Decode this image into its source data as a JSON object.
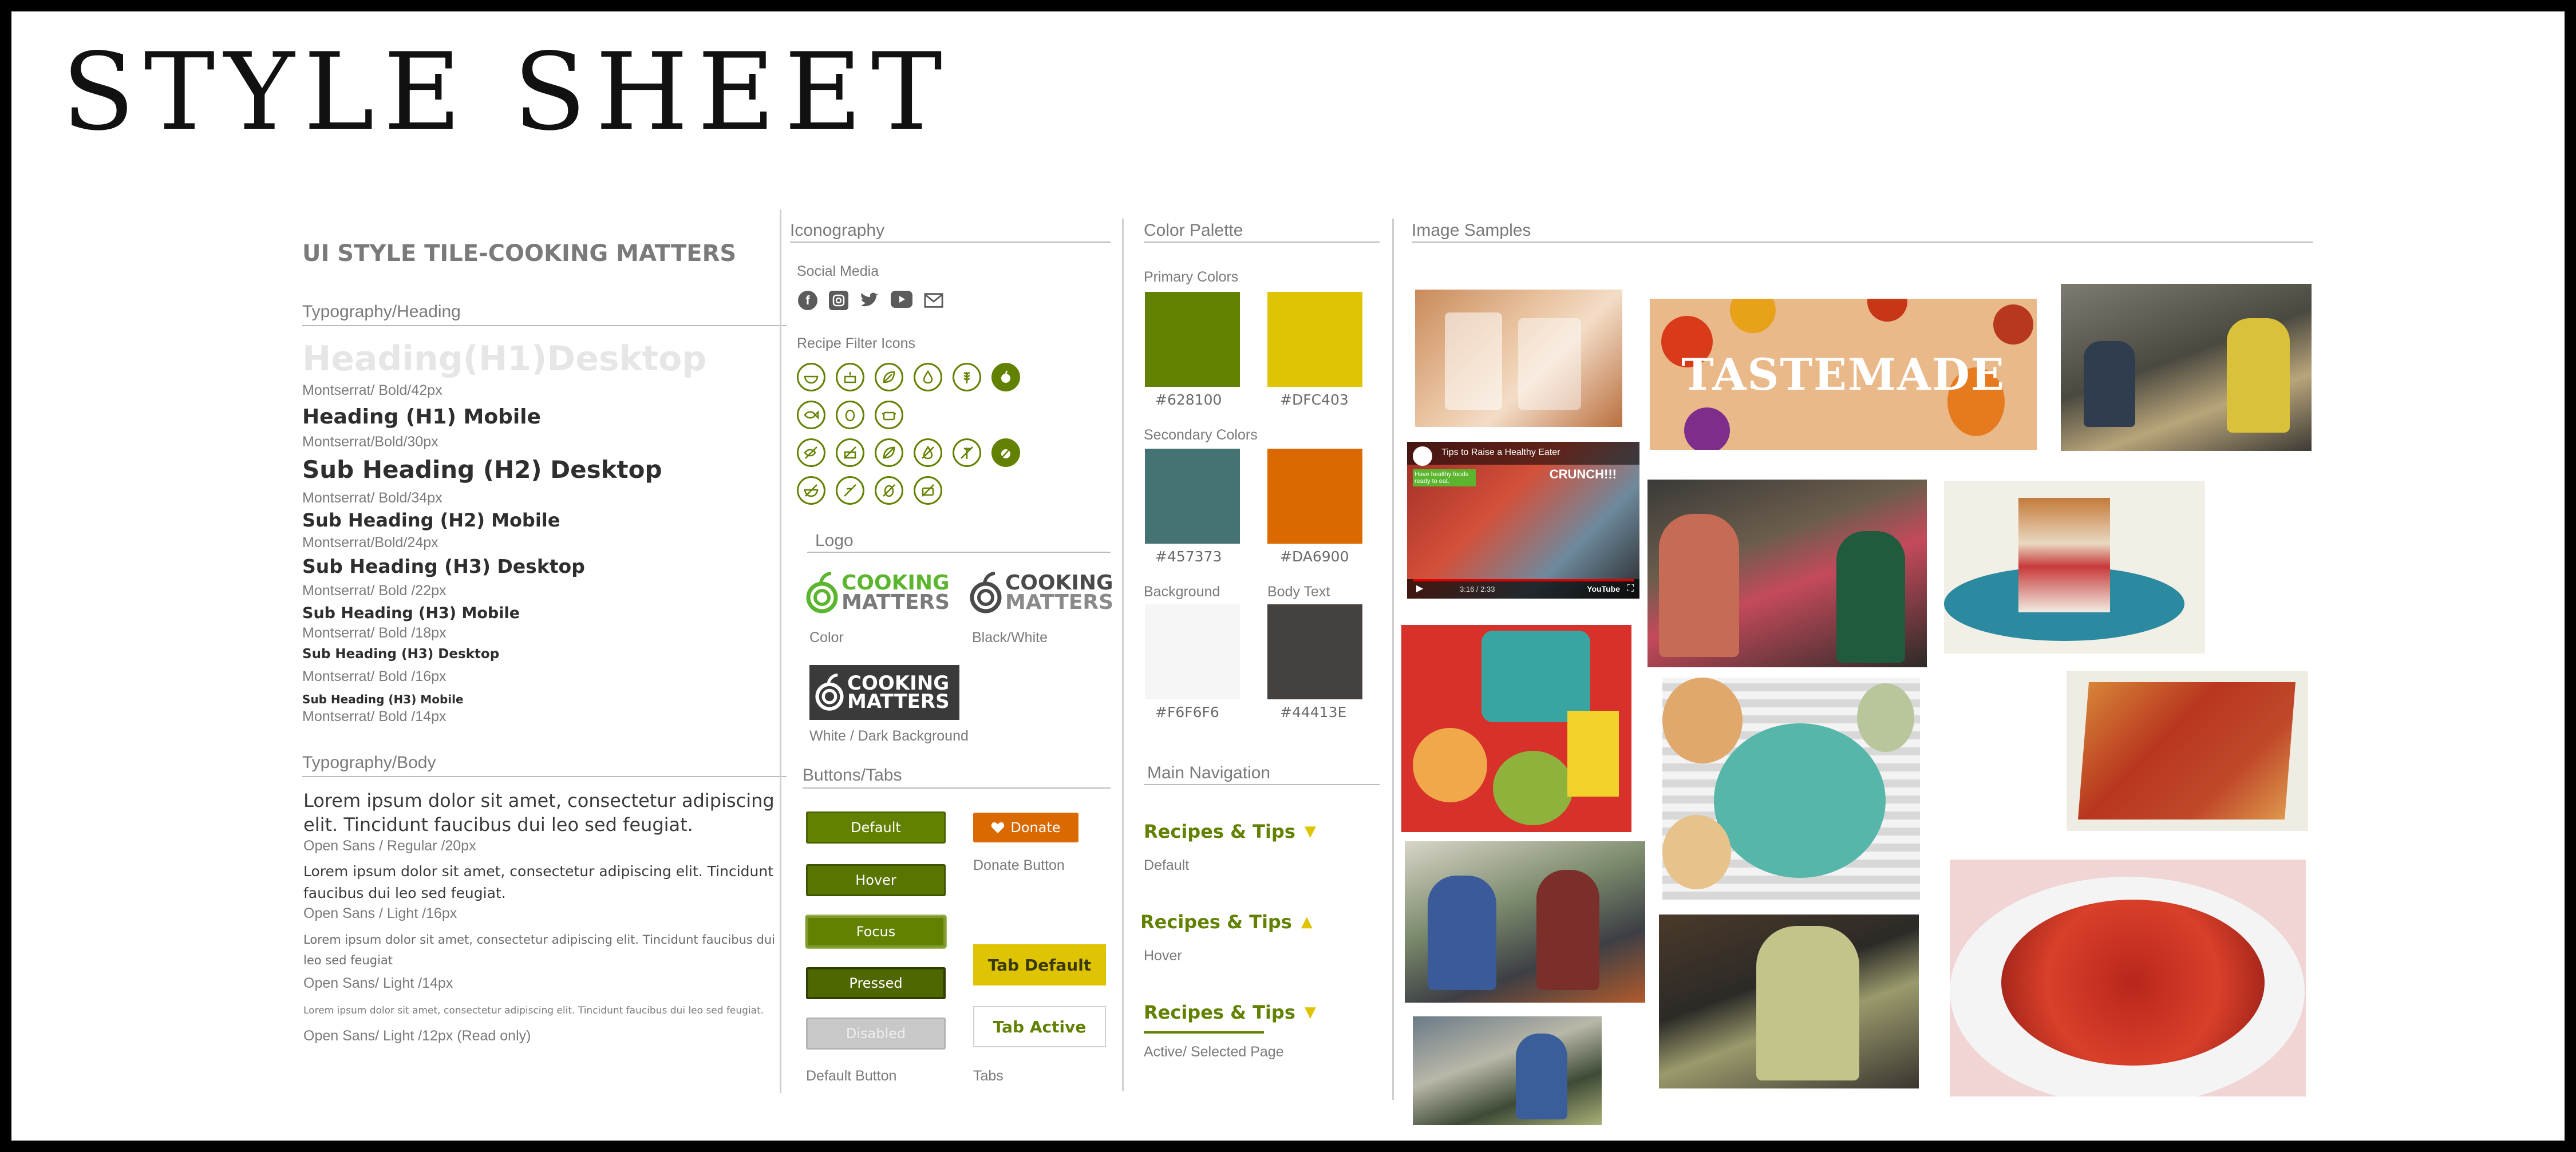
{
  "page_title": "STYLE SHEET",
  "typography": {
    "title": "UI STYLE TILE-COOKING MATTERS",
    "heading_section": "Typography/Heading",
    "items": [
      {
        "label": "Heading(H1)Desktop",
        "spec": "Montserrat/ Bold/42px"
      },
      {
        "label": "Heading (H1) Mobile",
        "spec": "Montserrat/Bold/30px"
      },
      {
        "label": "Sub Heading (H2) Desktop",
        "spec": "Montserrat/ Bold/34px"
      },
      {
        "label": "Sub Heading (H2) Mobile",
        "spec": "Montserrat/Bold/24px"
      },
      {
        "label": "Sub Heading (H3) Desktop",
        "spec": "Montserrat/ Bold /22px"
      },
      {
        "label": "Sub Heading (H3) Mobile",
        "spec": "Montserrat/ Bold /18px"
      },
      {
        "label": "Sub Heading (H3) Desktop",
        "spec": "Montserrat/ Bold /16px"
      },
      {
        "label": "Sub Heading (H3) Mobile",
        "spec": "Montserrat/ Bold /14px"
      }
    ],
    "body_section": "Typography/Body",
    "body": [
      {
        "text": "Lorem ipsum dolor sit amet, consectetur adipiscing elit. Tincidunt faucibus dui leo sed feugiat.",
        "spec": "Open Sans / Regular /20px"
      },
      {
        "text": "Lorem ipsum dolor sit amet, consectetur adipiscing elit. Tincidunt faucibus dui leo sed feugiat.",
        "spec": "Open Sans / Light /16px"
      },
      {
        "text": "Lorem ipsum dolor sit amet, consectetur adipiscing elit. Tincidunt faucibus dui leo sed feugiat",
        "spec": "Open Sans/ Light /14px"
      },
      {
        "text": "Lorem ipsum dolor sit amet, consectetur adipiscing elit. Tincidunt faucibus dui leo sed feugiat.",
        "spec": "Open Sans/ Light /12px (Read only)"
      }
    ]
  },
  "iconography": {
    "title": "Iconography",
    "social_label": "Social Media",
    "social_icons": [
      "facebook-icon",
      "instagram-icon",
      "twitter-icon",
      "youtube-icon",
      "email-icon"
    ],
    "filter_label": "Recipe Filter Icons",
    "logo_title": "Logo",
    "logo_text_top": "COOKING",
    "logo_text_bottom": "MATTERS",
    "logo_color_label": "Color",
    "logo_bw_label": "Black/White",
    "logo_dark_label": "White / Dark Background"
  },
  "buttons": {
    "title": "Buttons/Tabs",
    "states": [
      "Default",
      "Hover",
      "Focus",
      "Pressed",
      "Disabled"
    ],
    "default_caption": "Default Button",
    "donate_label": "Donate",
    "donate_caption": "Donate Button",
    "tab_default": "Tab Default",
    "tab_active": "Tab Active",
    "tabs_caption": "Tabs"
  },
  "palette": {
    "title": "Color Palette",
    "primary_label": "Primary Colors",
    "secondary_label": "Secondary Colors",
    "background_label": "Background",
    "body_text_label": "Body Text",
    "primary": [
      {
        "hex": "#628100"
      },
      {
        "hex": "#DFC403"
      }
    ],
    "secondary": [
      {
        "hex": "#457373"
      },
      {
        "hex": "#DA6900"
      }
    ],
    "neutral": [
      {
        "hex": "#F6F6F6"
      },
      {
        "hex": "#44413E"
      }
    ]
  },
  "navigation": {
    "title": "Main Navigation",
    "label": "Recipes & Tips",
    "states": [
      "Default",
      "Hover",
      "Active/ Selected Page"
    ]
  },
  "images": {
    "title": "Image Samples",
    "tastemade": "TASTEMADE",
    "video_title": "Tips to Raise a Healthy Eater",
    "video_overlay": "CRUNCH!!!",
    "video_caption": "Have healthy foods ready to eat.",
    "video_time": "3:16 / 2:33",
    "video_brand": "YouTube"
  }
}
